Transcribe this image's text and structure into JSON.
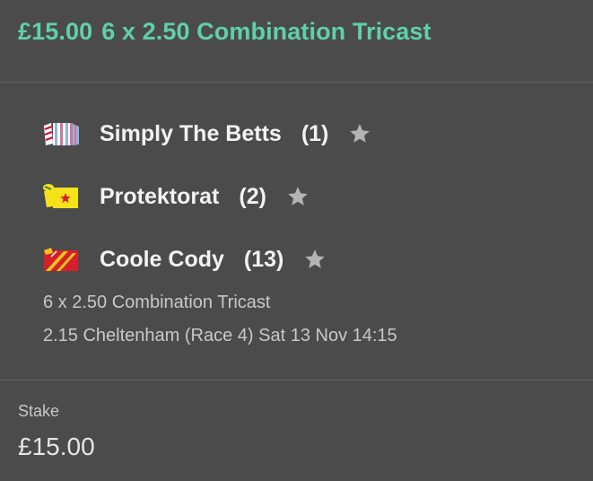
{
  "header": {
    "amount": "£15.00",
    "bet_description": "6 x 2.50 Combination Tricast"
  },
  "runners": [
    {
      "name": "Simply The Betts",
      "number": "(1)",
      "silk_icon": "silk-blue-white-icon",
      "favourite_icon": "star-icon"
    },
    {
      "name": "Protektorat",
      "number": "(2)",
      "silk_icon": "silk-yellow-red-star-icon",
      "favourite_icon": "star-icon"
    },
    {
      "name": "Coole Cody",
      "number": "(13)",
      "silk_icon": "silk-red-yellow-icon",
      "favourite_icon": "star-icon"
    }
  ],
  "bet_info": {
    "type": "6 x 2.50 Combination Tricast",
    "race": "2.15 Cheltenham (Race 4) Sat 13 Nov 14:15"
  },
  "stake": {
    "label": "Stake",
    "value": "£15.00"
  },
  "colors": {
    "background": "#4b4b4b",
    "accent": "#5fd1a8",
    "divider": "#656565",
    "star": "#b3b3b3"
  }
}
